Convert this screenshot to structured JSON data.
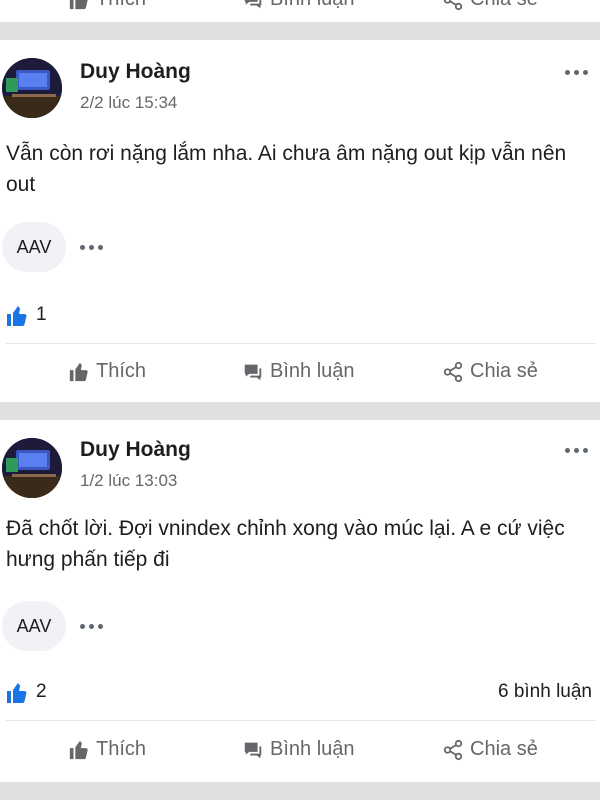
{
  "top_actions": {
    "like": "Thích",
    "comment": "Bình luận",
    "share": "Chia sẻ"
  },
  "posts": [
    {
      "author": "Duy Hoàng",
      "time": "2/2 lúc 15:34",
      "content": "Vẫn còn rơi nặng lắm nha. Ai chưa âm nặng out kịp vẫn nên out",
      "tag": "AAV",
      "likes": "1",
      "comments": "",
      "actions": {
        "like": "Thích",
        "comment": "Bình luận",
        "share": "Chia sẻ"
      }
    },
    {
      "author": "Duy Hoàng",
      "time": "1/2 lúc 13:03",
      "content": "Đã chốt lời. Đợi vnindex chỉnh xong vào múc lại. A e cứ việc hưng phấn tiếp đi",
      "tag": "AAV",
      "likes": "2",
      "comments": "6 bình luận",
      "actions": {
        "like": "Thích",
        "comment": "Bình luận",
        "share": "Chia sẻ"
      }
    }
  ],
  "colors": {
    "like_blue": "#1b74e4",
    "separator": "#dfe0e2",
    "muted": "#65676b"
  },
  "icons": [
    "thumbs-up-icon",
    "comment-bubble-icon",
    "share-icon",
    "more-dots-icon"
  ]
}
